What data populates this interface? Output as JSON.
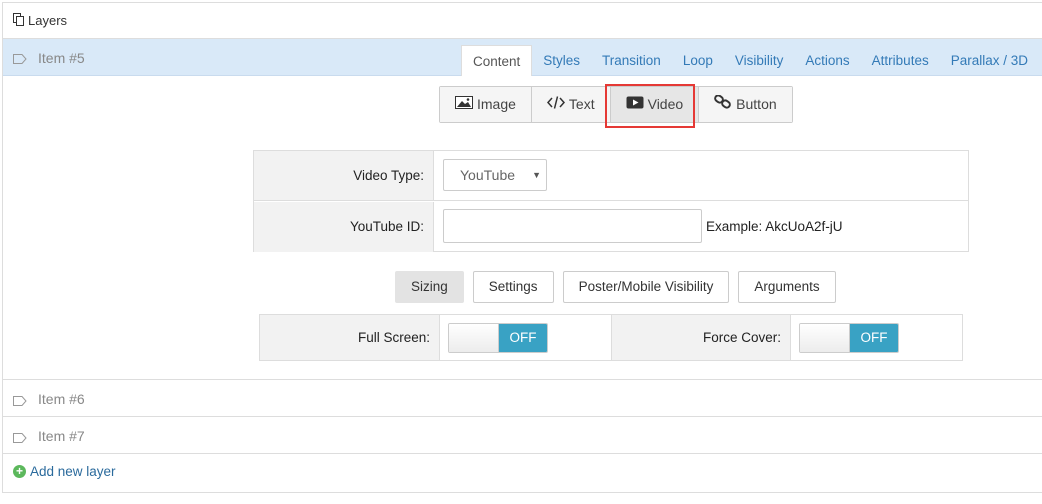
{
  "layers": {
    "title": "Layers",
    "icon": "copy-icon"
  },
  "items": {
    "item5": {
      "label": "Item #5",
      "icon": "tag-icon"
    },
    "item6": {
      "label": "Item #6",
      "icon": "tag-icon"
    },
    "item7": {
      "label": "Item #7",
      "icon": "tag-icon"
    }
  },
  "tabs": [
    "Content",
    "Styles",
    "Transition",
    "Loop",
    "Visibility",
    "Actions",
    "Attributes",
    "Parallax / 3D"
  ],
  "active_tab": "Content",
  "content_types": [
    {
      "label": "Image",
      "icon": "image-icon"
    },
    {
      "label": "Text",
      "icon": "code-icon"
    },
    {
      "label": "Video",
      "icon": "play-icon"
    },
    {
      "label": "Button",
      "icon": "link-icon"
    }
  ],
  "selected_content_type": "Video",
  "form": {
    "video_type_label": "Video Type:",
    "video_type_value": "YouTube",
    "youtube_id_label": "YouTube ID:",
    "youtube_id_value": "",
    "example_text": "Example: AkcUoA2f-jU"
  },
  "sub_tabs": [
    "Sizing",
    "Settings",
    "Poster/Mobile Visibility",
    "Arguments"
  ],
  "active_sub_tab": "Sizing",
  "toggles": {
    "full_screen_label": "Full Screen:",
    "full_screen_state": "OFF",
    "force_cover_label": "Force Cover:",
    "force_cover_state": "OFF"
  },
  "add_layer": {
    "label": "Add new layer",
    "icon": "plus-circle-icon"
  },
  "colors": {
    "accent": "#337ab7",
    "selected_row": "#d9e9f8",
    "toggle_on": "#39a2c4",
    "highlight": "#e53935",
    "add_green": "#5cb85c"
  }
}
